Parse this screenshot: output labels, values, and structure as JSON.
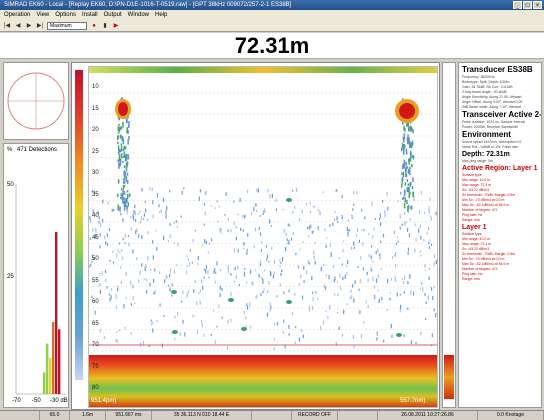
{
  "window": {
    "title": "SIMRAD EK60 - Local - [Replay EK60, D:\\PN-D1E-1016-T-0519.raw] - [GPT 38kHz 009072/257-2-1 ES38B]",
    "controls": [
      "_",
      "□",
      "×"
    ]
  },
  "menu": {
    "items": [
      "Operation",
      "View",
      "Options",
      "Install",
      "Output",
      "Window",
      "Help"
    ]
  },
  "toolbar": {
    "buttons": [
      "|◀",
      "◀",
      "▶",
      "▶|"
    ],
    "select_value": "Maximum",
    "rec_button": "●",
    "extra_buttons": [
      "▮",
      "▶"
    ]
  },
  "depth_banner": "72.31m",
  "histogram": {
    "title": "471 Detections",
    "y_labels": [
      "%",
      "50",
      "25"
    ],
    "x_labels": [
      "-70",
      "-50",
      "-30 dB"
    ],
    "bars": [
      {
        "x": 40,
        "value": 6,
        "color": "#8fcf4a"
      },
      {
        "x": 43,
        "value": 14,
        "color": "#8fcf4a"
      },
      {
        "x": 46,
        "value": 10,
        "color": "#e8d030"
      },
      {
        "x": 49,
        "value": 20,
        "color": "#d07020"
      },
      {
        "x": 52,
        "value": 45,
        "color": "#c0122e"
      },
      {
        "x": 55,
        "value": 18,
        "color": "#c0122e"
      }
    ]
  },
  "echogram": {
    "depth_labels": [
      "10",
      "15",
      "20",
      "25",
      "30",
      "35",
      "40",
      "45",
      "50",
      "55",
      "60",
      "65",
      "70",
      "75",
      "80"
    ],
    "foot_left": "951.4pm)",
    "foot_right": "557.7nm)"
  },
  "info_panel": {
    "transducer_title": "Transducer ES38B",
    "transducer_lines": [
      "Frequency: 38000Hz",
      "Beamtype: Split, Depth: 6.50m",
      "Gain: 26.78dB, Sa Corr: -0.61dB",
      "2-way beam angle: -20.60dB",
      "Angle Sensitivity, Along 21.90, Athwart",
      "Angle Offset, Along 0.00°, Athwart 0.00",
      "3dB Beam width, Along 7.10°, Athwart"
    ],
    "transceiver_title": "Transceiver Active 2-1",
    "transceiver_lines": [
      "Pulse duration: 1024 us, Sample Interval",
      "Power: 2000W, Receiver Bandwidth"
    ],
    "environment_title": "Environment",
    "environment_lines": [
      "Sound speed 1497m/s, Absorption 0.0",
      "Noise Est: -148dB re 1W, Pulse rate"
    ],
    "depth_value": "Depth: 72.31m",
    "ping_line": "Max ping range: 0m",
    "active_region_title": "Active Region: Layer 1",
    "active_region_lines": [
      "Surface type",
      "Min range: 10.0 m",
      "Max range: 72.4 m",
      "Sv: -63.22 dB/m3",
      "Sv threshold: -70dB, Margin: 0.5m",
      "Min Sv: -70 dB/m3 at 0.0 m",
      "Max Sv: -52.2dB/m3 at 54.9 m",
      "Number of targets: 471",
      "Ping rate: Hz",
      "Range:   m/s"
    ],
    "layer_title": "Layer 1",
    "layer_lines": [
      "Surface type",
      "Min range: 10.0 m",
      "Max range: 72.4 m",
      "Sv: -63.22 dB/m3",
      "Sv threshold: -70dB, Margin: 0.5m",
      "Min Sv: -70 dB/m3 at 0.0 m",
      "Max Sv: -52.2dB/m3 at 54.9 m",
      "Number of targets: 471",
      "Ping rate: Hz",
      "Range:   m/s"
    ]
  },
  "status_bar": [
    "",
    "65.0",
    "1.6m",
    "951.667 ms",
    "35 36.113 N  010 18.44 E",
    "",
    "RECORD OFF",
    "",
    "26.08.2011 10:27:26.86",
    "0.0 Knotage"
  ]
}
